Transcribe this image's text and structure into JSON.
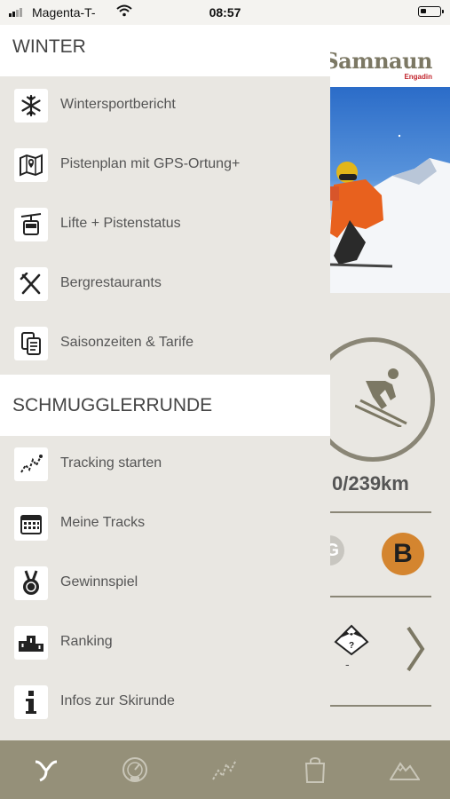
{
  "status": {
    "carrier": "Magenta-T-",
    "time": "08:57",
    "battery_level": 0.3
  },
  "drawer": {
    "sections": [
      {
        "title": "WINTER",
        "items": [
          {
            "label": "Wintersportbericht",
            "icon": "snowflake-icon"
          },
          {
            "label": "Pistenplan mit GPS-Ortung+",
            "icon": "map-pin-icon"
          },
          {
            "label": "Lifte + Pistenstatus",
            "icon": "gondola-icon"
          },
          {
            "label": "Bergrestaurants",
            "icon": "fork-knife-icon"
          },
          {
            "label": "Saisonzeiten & Tarife",
            "icon": "tickets-icon"
          }
        ]
      },
      {
        "title": "SCHMUGGLERRUNDE",
        "items": [
          {
            "label": "Tracking starten",
            "icon": "tracking-icon"
          },
          {
            "label": "Meine Tracks",
            "icon": "calendar-icon"
          },
          {
            "label": "Gewinnspiel",
            "icon": "medal-icon"
          },
          {
            "label": "Ranking",
            "icon": "podium-icon"
          },
          {
            "label": "Infos zur Skirunde",
            "icon": "info-icon"
          }
        ]
      }
    ]
  },
  "background": {
    "logo_title": "Samnaun",
    "logo_subtitle": "Engadin",
    "distance": "0/239km",
    "badge_b": "B",
    "badge_g_partial": "G",
    "avalanche_value": "-"
  },
  "tabbar": {
    "tabs": [
      {
        "icon": "home-swirl-icon",
        "active": true
      },
      {
        "icon": "speedometer-icon",
        "active": false
      },
      {
        "icon": "tracking-icon",
        "active": false
      },
      {
        "icon": "shopping-bag-icon",
        "active": false
      },
      {
        "icon": "mountain-icon",
        "active": false
      }
    ]
  },
  "colors": {
    "drawer_bg": "#e9e7e2",
    "tabbar_bg": "#959079",
    "badge_b": "#d4852f",
    "accent_red": "#c2262e"
  }
}
